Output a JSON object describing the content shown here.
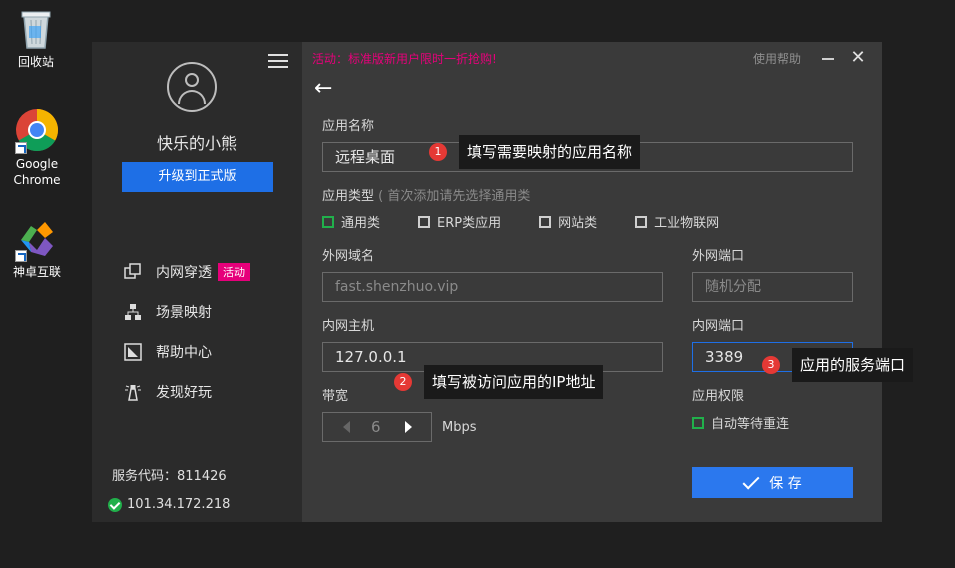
{
  "desktop": {
    "icons": [
      {
        "label": "回收站"
      },
      {
        "label": "Google Chrome"
      },
      {
        "label": "神卓互联"
      }
    ]
  },
  "sidebar": {
    "username": "快乐的小熊",
    "upgrade_label": "升级到正式版",
    "nav": [
      {
        "label": "内网穿透",
        "badge": "活动"
      },
      {
        "label": "场景映射"
      },
      {
        "label": "帮助中心"
      },
      {
        "label": "发现好玩"
      }
    ],
    "service_code": "服务代码：811426",
    "ip": "101.34.172.218"
  },
  "header": {
    "promo": "活动：标准版新用户限时一折抢购!",
    "help": "使用帮助",
    "close": "✕",
    "back": "←"
  },
  "form": {
    "app_name_label": "应用名称",
    "app_name_value": "远程桌面",
    "app_type_label": "应用类型",
    "app_type_hint": "( 首次添加请先选择通用类",
    "types": [
      {
        "label": "通用类",
        "checked": true
      },
      {
        "label": "ERP类应用",
        "checked": false
      },
      {
        "label": "网站类",
        "checked": false
      },
      {
        "label": "工业物联网",
        "checked": false
      }
    ],
    "ext_domain_label": "外网域名",
    "ext_domain_placeholder": "fast.shenzhuo.vip",
    "ext_port_label": "外网端口",
    "ext_port_placeholder": "随机分配",
    "int_host_label": "内网主机",
    "int_host_value": "127.0.0.1",
    "int_port_label": "内网端口",
    "int_port_value": "3389",
    "bandwidth_label": "带宽",
    "bandwidth_value": "6",
    "bandwidth_unit": "Mbps",
    "perm_label": "应用权限",
    "auto_reconnect_label": "自动等待重连",
    "save_label": "保 存"
  },
  "callouts": [
    {
      "num": "1",
      "text": "填写需要映射的应用名称"
    },
    {
      "num": "2",
      "text": "填写被访问应用的IP地址"
    },
    {
      "num": "3",
      "text": "应用的服务端口"
    }
  ],
  "colors": {
    "accent": "#1e6fe6",
    "promo": "#e6007a",
    "ok": "#21b04b"
  }
}
